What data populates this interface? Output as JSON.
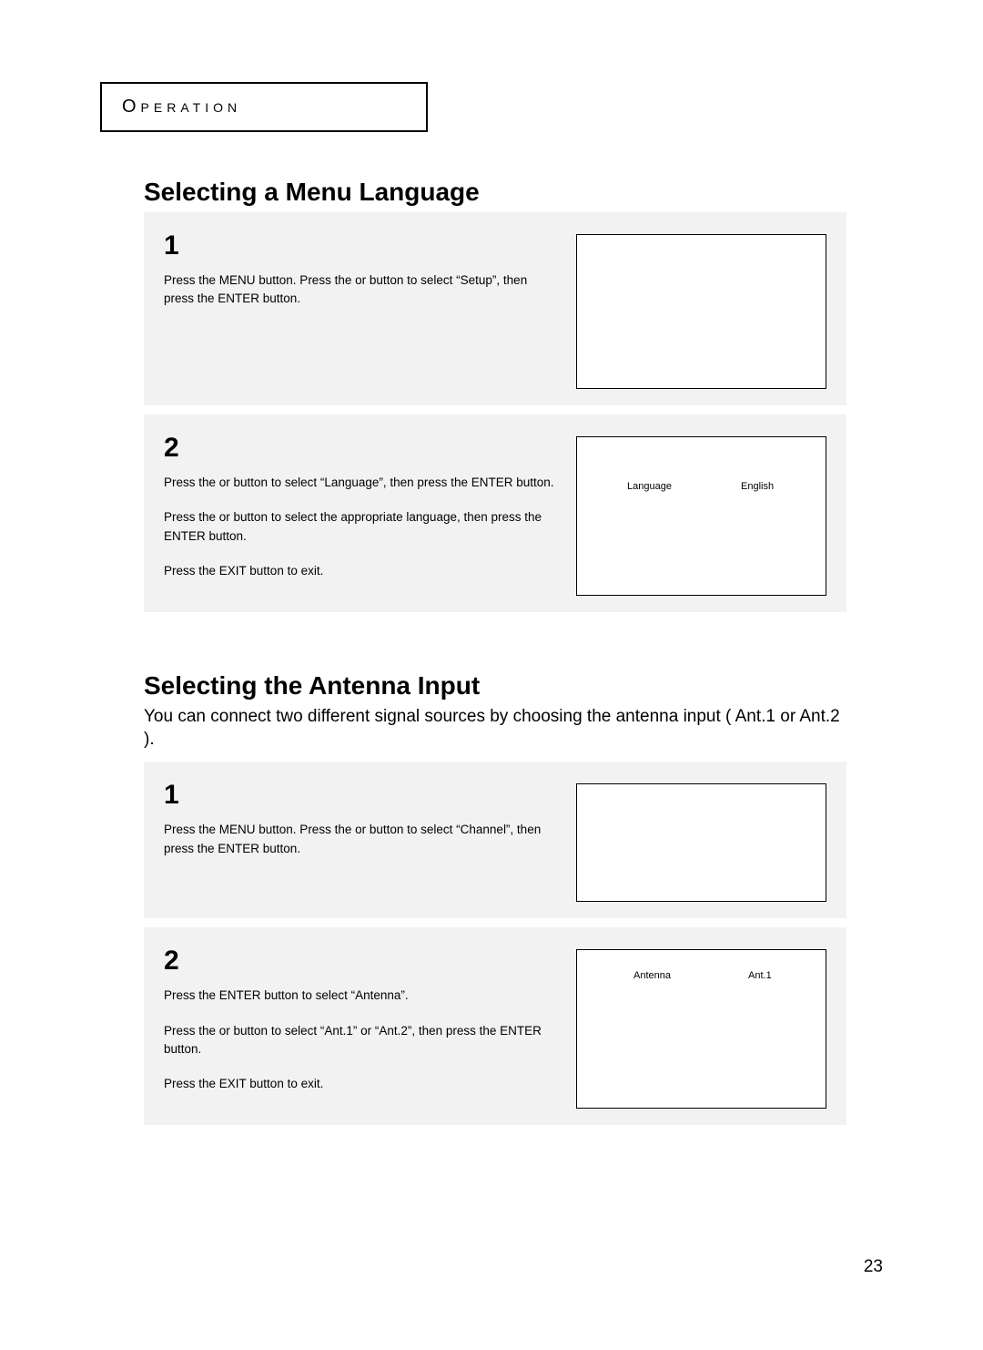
{
  "header": {
    "title": "Operation"
  },
  "section1": {
    "heading": "Selecting a Menu Language",
    "step1": {
      "num": "1",
      "p1": "Press the MENU button. Press the   or   button to select “Setup”, then press the ENTER button."
    },
    "step2": {
      "num": "2",
      "p1": "Press the   or   button to select “Language”, then press the ENTER button.",
      "p2": "Press the   or   button to select the appropriate language, then press the ENTER button.",
      "p3": "Press the EXIT button to exit.",
      "screen": {
        "label": "Language",
        "value": "English"
      }
    }
  },
  "section2": {
    "heading": "Selecting the Antenna Input",
    "intro": "You can connect two different signal sources by choosing the antenna input ( Ant.1  or  Ant.2 ).",
    "step1": {
      "num": "1",
      "p1": "Press the MENU button. Press the   or   button to select “Channel”, then press the ENTER button."
    },
    "step2": {
      "num": "2",
      "p1": "Press the ENTER button to select “Antenna”.",
      "p2": "Press the   or   button to select “Ant.1” or “Ant.2”,  then press the ENTER button.",
      "p3": "Press the EXIT button to exit.",
      "screen": {
        "label": "Antenna",
        "value": "Ant.1"
      }
    }
  },
  "pageNumber": "23"
}
